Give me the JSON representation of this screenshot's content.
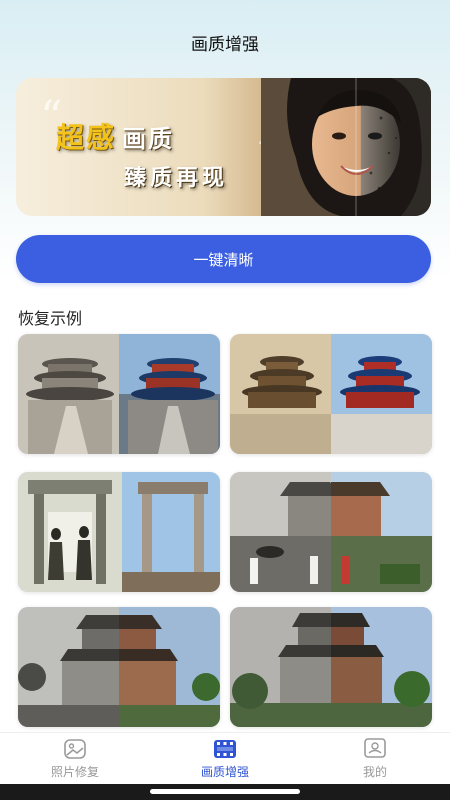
{
  "header": {
    "title": "画质增强"
  },
  "banner": {
    "highlight": "超感",
    "line1_rest": "画质",
    "line2": "臻质再现"
  },
  "primary_button": {
    "label": "一键清晰"
  },
  "examples": {
    "title": "恢复示例",
    "items": [
      {
        "subject": "temple-of-heaven-stairs"
      },
      {
        "subject": "temple-of-heaven"
      },
      {
        "subject": "archway-women"
      },
      {
        "subject": "tower-street-scene"
      },
      {
        "subject": "drum-tower"
      },
      {
        "subject": "drum-tower-color"
      }
    ]
  },
  "tabbar": {
    "tabs": [
      {
        "label": "照片修复",
        "icon": "photo-icon",
        "active": false
      },
      {
        "label": "画质增强",
        "icon": "film-icon",
        "active": true
      },
      {
        "label": "我的",
        "icon": "profile-icon",
        "active": false
      }
    ]
  },
  "colors": {
    "accent": "#3b5fe0",
    "active_tab": "#2f55d4",
    "inactive_tab": "#999999"
  }
}
